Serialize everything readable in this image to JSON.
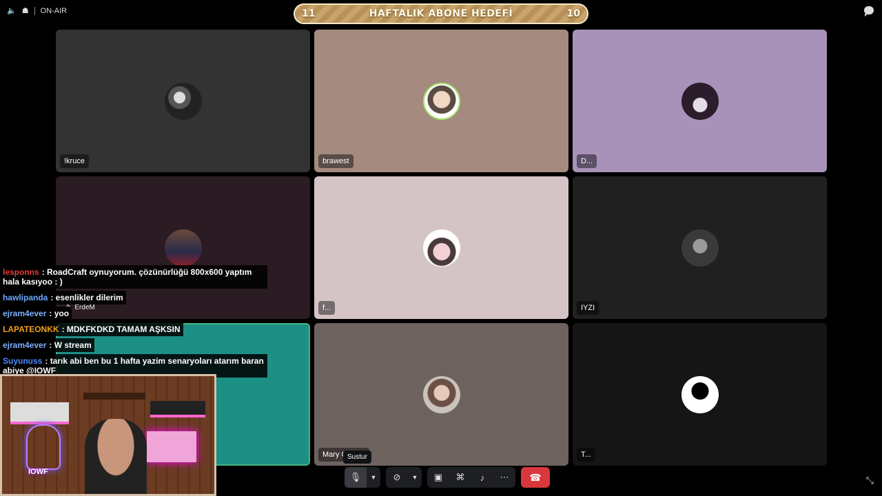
{
  "topbar": {
    "status": "ON-AIR",
    "goal": {
      "left": "11",
      "title": "HAFTALIK ABONE HEDEFİ",
      "right": "10"
    }
  },
  "tiles": [
    {
      "name": "!kruce"
    },
    {
      "name": "brawest"
    },
    {
      "name": "D..."
    },
    {
      "name": ""
    },
    {
      "name": "f..."
    },
    {
      "name": "IYZI"
    },
    {
      "name": ""
    },
    {
      "name": "Mary C... ...y"
    },
    {
      "name": "T..."
    }
  ],
  "speaker_overlay": "ErdeM",
  "chat": [
    {
      "user": "lesponns",
      "color": "#e33b3b",
      "text": ": RoadCraft oynuyorum. çözünürlüğü 800x600 yaptım hala kasıyoo : )"
    },
    {
      "user": "hawlipanda",
      "color": "#6fa8ff",
      "text": ": esenlikler dilerim"
    },
    {
      "user": "ejram4ever",
      "color": "#7fb0ff",
      "text": ": yoo"
    },
    {
      "user": "LAPATEONKK",
      "color": "#f0a020",
      "text": ": MDKFKDKD TAMAM AŞKSIN"
    },
    {
      "user": "ejram4ever",
      "color": "#7fb0ff",
      "text": ": W stream"
    },
    {
      "user": "Suyunuss",
      "color": "#4e8cff",
      "text": ": tarık abi ben bu 1 hafta yazim senaryoları atarım baran abiye @IOWF"
    }
  ],
  "webcam": {
    "logo_text": "IOWF"
  },
  "controls": {
    "tooltip": "Sustur"
  },
  "icons": {
    "speaker": "speaker-icon",
    "mic": "mic-icon",
    "camera_off": "camera-off-icon",
    "screen_share": "screen-share-icon",
    "activity": "gamepad-icon",
    "soundboard": "soundboard-icon",
    "more": "more-icon",
    "hangup": "hangup-icon",
    "chat": "chat-icon",
    "minimize": "minimize-icon"
  },
  "colors": {
    "speaking_border": "#43b581",
    "hangup": "#da373c"
  }
}
